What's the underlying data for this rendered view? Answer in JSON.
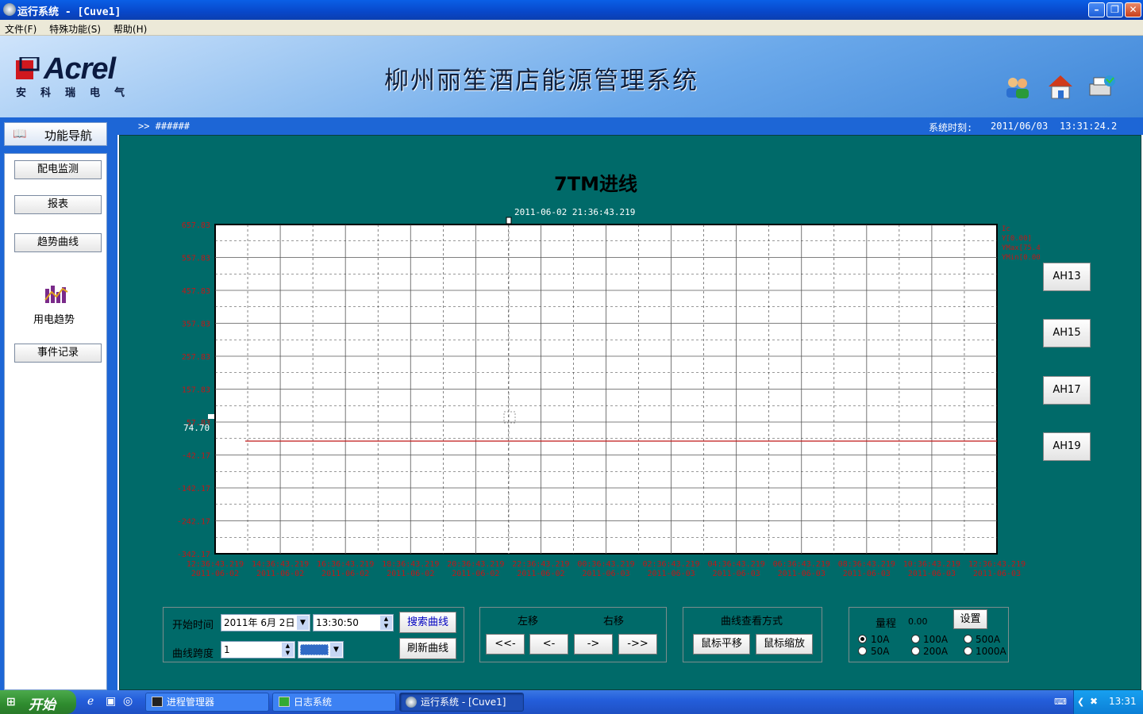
{
  "window": {
    "title": "运行系统 - [Cuve1]"
  },
  "menu": [
    "文件(F)",
    "特殊功能(S)",
    "帮助(H)"
  ],
  "header": {
    "brand": "Acrel",
    "brand_sub": "安科瑞电气",
    "title": "柳州丽笙酒店能源管理系统"
  },
  "nav": {
    "heading": "功能导航",
    "items": [
      "配电监测",
      "报表",
      "趋势曲线",
      "事件记录"
    ],
    "active_label": "用电趋势"
  },
  "status": {
    "path": ">> ######",
    "time_label": "系统时刻:",
    "date": "2011/06/03",
    "time": "13:31:24.2"
  },
  "chart_data": {
    "type": "line",
    "title": "7TM进线",
    "cursor_label": "2011-06-02 21:36:43.219",
    "y_ticks": [
      "657.83",
      "557.83",
      "457.83",
      "357.83",
      "257.83",
      "157.83",
      "57.83",
      "-42.17",
      "-142.17",
      "-242.17",
      "-342.17"
    ],
    "ylim": [
      -342.17,
      657.83
    ],
    "x_times": [
      "12:36:43.219",
      "14:36:43.219",
      "16:36:43.219",
      "18:36:43.219",
      "20:36:43.219",
      "22:36:43.219",
      "00:36:43.219",
      "02:36:43.219",
      "04:36:43.219",
      "06:36:43.219",
      "08:36:43.219",
      "10:36:43.219",
      "12:36:43.219"
    ],
    "x_dates": [
      "2011-06-02",
      "2011-06-02",
      "2011-06-02",
      "2011-06-02",
      "2011-06-02",
      "2011-06-02",
      "2011-06-03",
      "2011-06-03",
      "2011-06-03",
      "2011-06-03",
      "2011-06-03",
      "2011-06-03",
      "2011-06-03"
    ],
    "series": [
      {
        "values": [
          0,
          0
        ]
      }
    ],
    "marker_value": "74.70",
    "legend": [
      "Ic",
      "Y[0.00]",
      "YMax[75.40]",
      "YMin[0.00]"
    ],
    "line_color": "#c01818",
    "grid": true
  },
  "side_buttons": [
    "AH13",
    "AH15",
    "AH17",
    "AH19"
  ],
  "search": {
    "start_label": "开始时间",
    "start_date": "2011年 6月 2日",
    "start_time": "13:30:50",
    "span_label": "曲线跨度",
    "span_value": "1",
    "search_btn": "搜索曲线",
    "refresh_btn": "刷新曲线"
  },
  "shift": {
    "left_label": "左移",
    "right_label": "右移",
    "buttons": [
      "<<-",
      "<-",
      "->",
      "->>"
    ]
  },
  "view": {
    "label": "曲线查看方式",
    "pan_btn": "鼠标平移",
    "zoom_btn": "鼠标缩放"
  },
  "range": {
    "label": "量程",
    "value": "0.00",
    "set_btn": "设置",
    "options": [
      "10A",
      "100A",
      "500A",
      "50A",
      "200A",
      "1000A"
    ],
    "selected": "10A"
  },
  "taskbar": {
    "start": "开始",
    "tasks": [
      "进程管理器",
      "日志系统",
      "运行系统 - [Cuve1]"
    ],
    "clock": "13:31"
  },
  "colors": {
    "content_bg": "#006a69",
    "axis_text": "#c01818"
  }
}
